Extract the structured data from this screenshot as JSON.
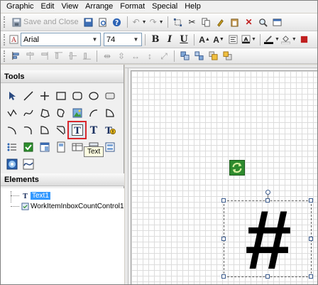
{
  "menu": [
    "Graphic",
    "Edit",
    "View",
    "Arrange",
    "Format",
    "Special",
    "Help"
  ],
  "toolbar": {
    "save_close_label": "Save and Close",
    "font_name": "Arial",
    "font_size": "74",
    "bold_label": "B",
    "italic_label": "I",
    "underline_label": "U"
  },
  "tools": {
    "header": "Tools",
    "tooltip": "Text",
    "text_tool_glyph": "T"
  },
  "elements": {
    "header": "Elements",
    "items": [
      {
        "label": "Text1",
        "selected": true
      },
      {
        "label": "WorkItemInboxCountControl1",
        "selected": false
      }
    ]
  },
  "canvas": {
    "text_content": "#"
  },
  "colors": {
    "selection": "#3399ff",
    "highlight_border": "#d9282d",
    "refresh_bg": "#2e8b2e"
  }
}
